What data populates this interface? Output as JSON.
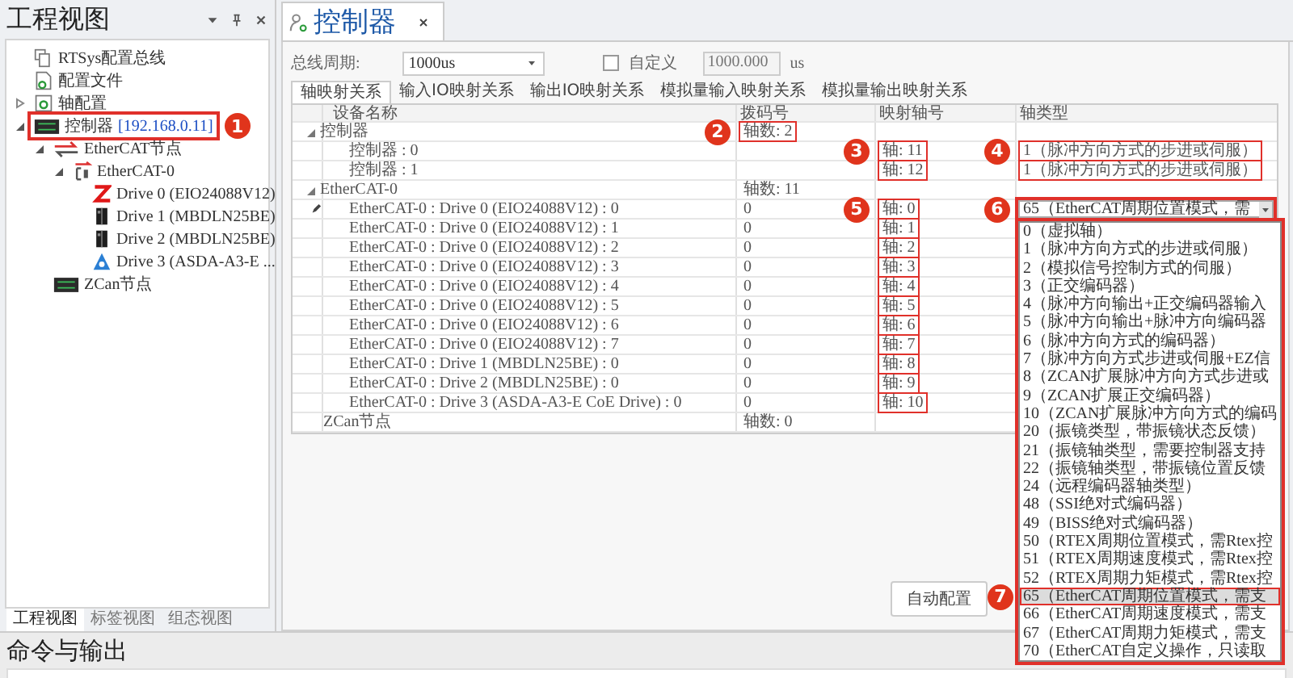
{
  "project_panel": {
    "title": "工程视图",
    "tree": [
      {
        "label": "RTSys配置总线",
        "kind": "bus"
      },
      {
        "label": "配置文件",
        "kind": "file"
      },
      {
        "label": "轴配置",
        "kind": "axis",
        "expanded": false
      },
      {
        "label": "控制器",
        "address": "[192.168.0.11]",
        "kind": "controller",
        "expanded": true,
        "callout": "1",
        "children": [
          {
            "label": "EtherCAT节点",
            "kind": "ethercat",
            "expanded": true,
            "children": [
              {
                "label": "EtherCAT-0",
                "kind": "port",
                "expanded": true,
                "children": [
                  {
                    "label": "Drive 0 (EIO24088V12)",
                    "kind": "io"
                  },
                  {
                    "label": "Drive 1 (MBDLN25BE)",
                    "kind": "servo"
                  },
                  {
                    "label": "Drive 2 (MBDLN25BE)",
                    "kind": "servo"
                  },
                  {
                    "label": "Drive 3 (ASDA-A3-E ...",
                    "kind": "triangle"
                  }
                ]
              }
            ]
          },
          {
            "label": "ZCan节点",
            "kind": "controller"
          }
        ]
      }
    ],
    "tabs": [
      {
        "label": "工程视图",
        "selected": true
      },
      {
        "label": "标签视图",
        "selected": false
      },
      {
        "label": "组态视图",
        "selected": false
      }
    ]
  },
  "document_tab": {
    "title": "控制器"
  },
  "form": {
    "cycle_label": "总线周期:",
    "cycle_value": "1000us",
    "custom_label": "自定义",
    "custom_checked": false,
    "custom_value": "1000.000",
    "unit": "us"
  },
  "subtabs": [
    {
      "label": "轴映射关系",
      "selected": true
    },
    {
      "label": "输入IO映射关系",
      "selected": false
    },
    {
      "label": "输出IO映射关系",
      "selected": false
    },
    {
      "label": "模拟量输入映射关系",
      "selected": false
    },
    {
      "label": "模拟量输出映射关系",
      "selected": false
    }
  ],
  "table": {
    "columns": [
      "设备名称",
      "拨码号",
      "映射轴号",
      "轴类型"
    ],
    "rows": [
      {
        "kind": "group",
        "name": "控制器",
        "expanded": true,
        "dip": {
          "text": "轴数: 2",
          "outlined": true,
          "callout": "2"
        }
      },
      {
        "kind": "item",
        "name": "控制器 : 0",
        "axis": {
          "text": "轴: 11",
          "outlined": true,
          "callout": "3"
        },
        "type": {
          "text": "1（脉冲方向方式的步进或伺服）",
          "outlined": true,
          "callout": "4"
        }
      },
      {
        "kind": "item",
        "name": "控制器 : 1",
        "axis": {
          "text": "轴: 12",
          "outlined": true
        },
        "type": {
          "text": "1（脉冲方向方式的步进或伺服）",
          "outlined": true
        }
      },
      {
        "kind": "group",
        "name": "EtherCAT-0",
        "expanded": true,
        "dip": {
          "text": "轴数: 11"
        }
      },
      {
        "kind": "item",
        "name": "EtherCAT-0 : Drive 0 (EIO24088V12) : 0",
        "editing": true,
        "dip": {
          "text": "0"
        },
        "axis": {
          "text": "轴: 0",
          "outlined": true,
          "callout": "5"
        }
      },
      {
        "kind": "item",
        "name": "EtherCAT-0 : Drive 0 (EIO24088V12) : 1",
        "dip": {
          "text": "0"
        },
        "axis": {
          "text": "轴: 1",
          "outlined": true
        }
      },
      {
        "kind": "item",
        "name": "EtherCAT-0 : Drive 0 (EIO24088V12) : 2",
        "dip": {
          "text": "0"
        },
        "axis": {
          "text": "轴: 2",
          "outlined": true
        }
      },
      {
        "kind": "item",
        "name": "EtherCAT-0 : Drive 0 (EIO24088V12) : 3",
        "dip": {
          "text": "0"
        },
        "axis": {
          "text": "轴: 3",
          "outlined": true
        }
      },
      {
        "kind": "item",
        "name": "EtherCAT-0 : Drive 0 (EIO24088V12) : 4",
        "dip": {
          "text": "0"
        },
        "axis": {
          "text": "轴: 4",
          "outlined": true
        }
      },
      {
        "kind": "item",
        "name": "EtherCAT-0 : Drive 0 (EIO24088V12) : 5",
        "dip": {
          "text": "0"
        },
        "axis": {
          "text": "轴: 5",
          "outlined": true
        }
      },
      {
        "kind": "item",
        "name": "EtherCAT-0 : Drive 0 (EIO24088V12) : 6",
        "dip": {
          "text": "0"
        },
        "axis": {
          "text": "轴: 6",
          "outlined": true
        }
      },
      {
        "kind": "item",
        "name": "EtherCAT-0 : Drive 0 (EIO24088V12) : 7",
        "dip": {
          "text": "0"
        },
        "axis": {
          "text": "轴: 7",
          "outlined": true
        }
      },
      {
        "kind": "item",
        "name": "EtherCAT-0 : Drive 1 (MBDLN25BE) : 0",
        "dip": {
          "text": "0"
        },
        "axis": {
          "text": "轴: 8",
          "outlined": true
        }
      },
      {
        "kind": "item",
        "name": "EtherCAT-0 : Drive 2 (MBDLN25BE) : 0",
        "dip": {
          "text": "0"
        },
        "axis": {
          "text": "轴: 9",
          "outlined": true
        }
      },
      {
        "kind": "item",
        "name": "EtherCAT-0 : Drive 3 (ASDA-A3-E CoE Drive) : 0",
        "dip": {
          "text": "0"
        },
        "axis": {
          "text": "轴: 10",
          "outlined": true
        }
      },
      {
        "kind": "group",
        "name": "ZCan节点",
        "dip": {
          "text": "轴数: 0"
        }
      }
    ]
  },
  "type_editor": {
    "value": "65（EtherCAT周期位置模式，需",
    "callout": "6",
    "options": [
      {
        "label": "0（虚拟轴）",
        "selected": false
      },
      {
        "label": "1（脉冲方向方式的步进或伺服）",
        "selected": false
      },
      {
        "label": "2（模拟信号控制方式的伺服）",
        "selected": false
      },
      {
        "label": "3（正交编码器）",
        "selected": false
      },
      {
        "label": "4（脉冲方向输出+正交编码器输入",
        "selected": false
      },
      {
        "label": "5（脉冲方向输出+脉冲方向编码器",
        "selected": false
      },
      {
        "label": "6（脉冲方向方式的编码器）",
        "selected": false
      },
      {
        "label": "7（脉冲方向方式步进或伺服+EZ信",
        "selected": false
      },
      {
        "label": "8（ZCAN扩展脉冲方向方式步进或",
        "selected": false
      },
      {
        "label": "9（ZCAN扩展正交编码器）",
        "selected": false
      },
      {
        "label": "10（ZCAN扩展脉冲方向方式的编码",
        "selected": false
      },
      {
        "label": "20（振镜类型，带振镜状态反馈）",
        "selected": false
      },
      {
        "label": "21（振镜轴类型，需要控制器支持",
        "selected": false
      },
      {
        "label": "22（振镜轴类型，带振镜位置反馈",
        "selected": false
      },
      {
        "label": "24（远程编码器轴类型）",
        "selected": false
      },
      {
        "label": "48（SSI绝对式编码器）",
        "selected": false
      },
      {
        "label": "49（BISS绝对式编码器）",
        "selected": false
      },
      {
        "label": "50（RTEX周期位置模式，需Rtex控",
        "selected": false
      },
      {
        "label": "51（RTEX周期速度模式，需Rtex控",
        "selected": false
      },
      {
        "label": "52（RTEX周期力矩模式，需Rtex控",
        "selected": false
      },
      {
        "label": "65（EtherCAT周期位置模式，需支",
        "selected": true,
        "callout": "7"
      },
      {
        "label": "66（EtherCAT周期速度模式，需支",
        "selected": false
      },
      {
        "label": "67（EtherCAT周期力矩模式，需支",
        "selected": false
      },
      {
        "label": "70（EtherCAT自定义操作，只读取",
        "selected": false
      }
    ]
  },
  "buttons": [
    {
      "label": "自动配置"
    }
  ],
  "output_panel": {
    "title": "命令与输出"
  }
}
